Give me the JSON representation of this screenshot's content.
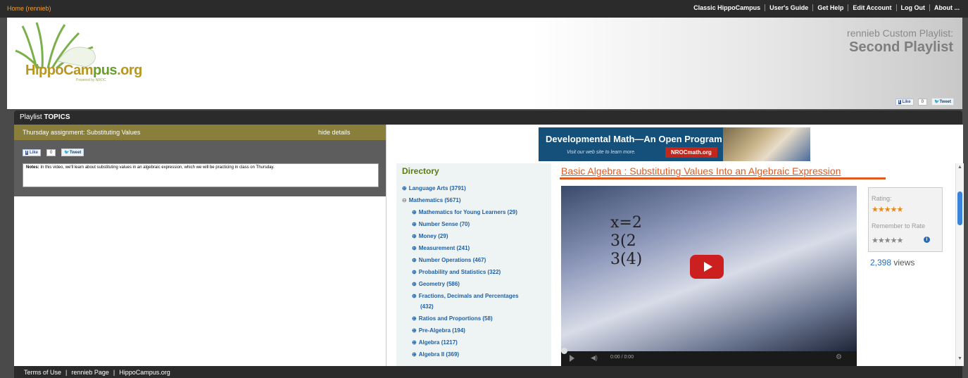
{
  "topbar": {
    "home_link": "Home (rennieb)",
    "links": [
      "Classic HippoCampus",
      "User's Guide",
      "Get Help",
      "Edit Account",
      "Log Out",
      "About ..."
    ]
  },
  "header": {
    "logo_text_a": "HippoCam",
    "logo_text_b": "pus",
    "logo_text_c": ".org",
    "logo_sub": "Powered by NROC",
    "playlist_owner": "rennieb Custom Playlist:",
    "playlist_name": "Second Playlist",
    "like_label": "Like",
    "like_count": "0",
    "tweet_label": "Tweet"
  },
  "topics": {
    "title_prefix": "Playlist ",
    "title_bold": "TOPICS"
  },
  "assignment": {
    "title": "Thursday assignment: Substituting Values",
    "hide_details": "hide details",
    "like_label": "Like",
    "like_count": "0",
    "tweet_label": "Tweet",
    "notes_label": "Notes:",
    "notes_text": " In this video, we'll learn about substituting values in an algebraic expression, which we will be practicing in class on Thursday."
  },
  "banner": {
    "title": "Developmental Math—An Open Program",
    "subtitle": "Visit our web site to learn more.",
    "button": "NROCmath.org"
  },
  "directory": {
    "title": "Directory",
    "items": [
      {
        "label": "Language Arts (3791)",
        "icon": "+"
      },
      {
        "label": "Mathematics (5671)",
        "icon": "-"
      },
      {
        "label": "Mathematics for Young Learners (29)",
        "icon": "+"
      },
      {
        "label": "Number Sense (70)",
        "icon": "+"
      },
      {
        "label": "Money (29)",
        "icon": "+"
      },
      {
        "label": "Measurement (241)",
        "icon": "+"
      },
      {
        "label": "Number Operations (467)",
        "icon": "+"
      },
      {
        "label": "Probability and Statistics (322)",
        "icon": "+"
      },
      {
        "label": "Geometry (586)",
        "icon": "+"
      },
      {
        "label": "Fractions, Decimals and Percentages",
        "icon": "+"
      },
      {
        "label": "(432)",
        "icon": ""
      },
      {
        "label": "Ratios and Proportions (58)",
        "icon": "+"
      },
      {
        "label": "Pre-Algebra (194)",
        "icon": "+"
      },
      {
        "label": "Algebra (1217)",
        "icon": "+"
      },
      {
        "label": "Algebra II (369)",
        "icon": "+"
      }
    ]
  },
  "video": {
    "title": "Basic Algebra : Substituting Values Into an Algebraic Expression",
    "frame_text_1": "x=2",
    "frame_text_2": "3(2",
    "frame_text_3": "3(4)",
    "time": "0:00 / 0:00"
  },
  "rating": {
    "label": "Rating:",
    "stars": "★★★★★",
    "remember_label": "Remember to Rate",
    "remember_stars": "★★★★★",
    "views_count": "2,398",
    "views_label": " views"
  },
  "footer": {
    "links": [
      "Terms of Use",
      "rennieb Page",
      "HippoCampus.org"
    ]
  },
  "colors": {
    "accent_orange": "#e05a1e",
    "link_blue": "#1f5fa6",
    "olive_bar": "#8a7f3a"
  }
}
